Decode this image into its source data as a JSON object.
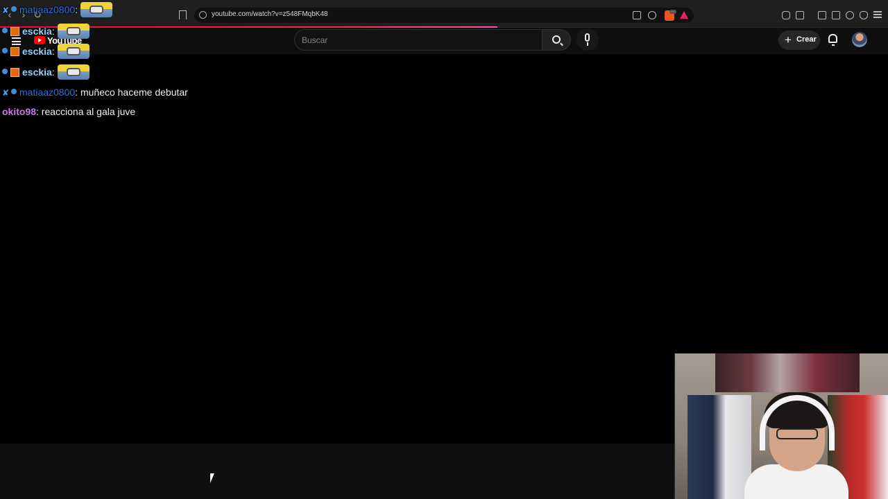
{
  "browser": {
    "url": "youtube.com/watch?v=z548FMqbK48",
    "icons": [
      "back-icon",
      "forward-icon",
      "reload-icon",
      "bookmark-icon",
      "site-info-icon",
      "cast-icon",
      "share-icon",
      "brave-shields-icon",
      "brave-rewards-icon",
      "extensions-icon",
      "sidebar-icon",
      "wallet-icon",
      "leo-icon",
      "vpn-icon",
      "menu-icon"
    ]
  },
  "youtube": {
    "logo_text": "YouTube",
    "search_placeholder": "Buscar",
    "create_label": "Crear",
    "icons": [
      "hamburger-menu-icon",
      "youtube-logo-icon",
      "search-icon",
      "microphone-icon",
      "plus-icon",
      "notifications-bell-icon",
      "avatar"
    ]
  },
  "chat": {
    "messages": [
      {
        "user": "matiaaz0800",
        "separator": ":",
        "text": "",
        "emote": "minion-emote",
        "user_color": "#2e6fdf"
      },
      {
        "user": "esckia",
        "separator": ":",
        "text": "",
        "emote": "minion-emote",
        "user_color": "#8fd0ff"
      },
      {
        "user": "esckia",
        "separator": ":",
        "text": "",
        "emote": "minion-emote",
        "user_color": "#8fd0ff"
      },
      {
        "user": "esckia",
        "separator": ":",
        "text": "",
        "emote": "minion-emote",
        "user_color": "#8fd0ff"
      },
      {
        "user": "matiaaz0800",
        "separator": ":",
        "text": "muñeco haceme debutar",
        "user_color": "#2e6fdf"
      },
      {
        "user": "okito98",
        "separator": ":",
        "text": "reacciona al gala juve",
        "user_color": "#cc77ee"
      }
    ]
  },
  "colors": {
    "background": "#000000",
    "chrome": "#1f1f1f",
    "youtube_header": "#0f0f0f",
    "loading_bar": "#ff0033"
  }
}
